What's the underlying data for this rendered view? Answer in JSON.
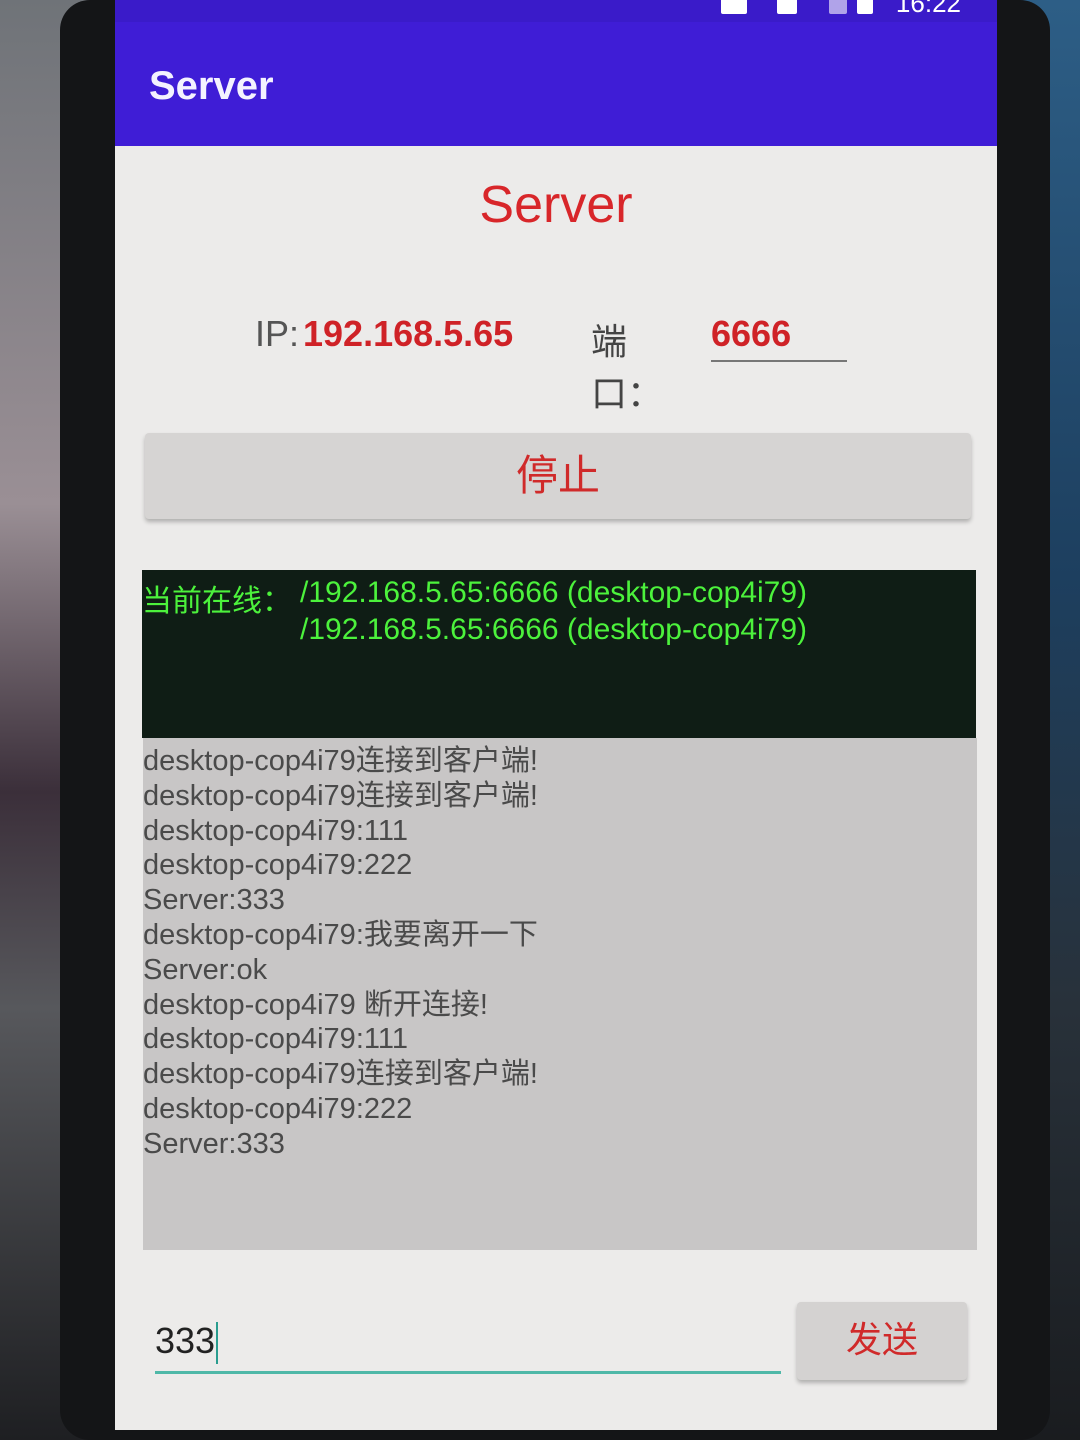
{
  "status_bar": {
    "time": "16:22"
  },
  "app_bar": {
    "title": "Server"
  },
  "main": {
    "heading": "Server",
    "ip_label": "IP:",
    "ip_value": "192.168.5.65",
    "port_label": "端口：",
    "port_value": "6666",
    "stop_button": "停止"
  },
  "online": {
    "label": "当前在线：",
    "clients": [
      "/192.168.5.65:6666 (desktop-cop4i79)",
      "/192.168.5.65:6666 (desktop-cop4i79)"
    ]
  },
  "log": [
    "desktop-cop4i79连接到客户端!",
    "desktop-cop4i79连接到客户端!",
    "desktop-cop4i79:111",
    "desktop-cop4i79:222",
    "Server:333",
    "desktop-cop4i79:我要离开一下",
    "Server:ok",
    "desktop-cop4i79 断开连接!",
    "desktop-cop4i79:111",
    "desktop-cop4i79连接到客户端!",
    "desktop-cop4i79:222",
    "Server:333"
  ],
  "composer": {
    "input_value": "333",
    "send_button": "发送"
  },
  "colors": {
    "app_bar": "#3f1dd6",
    "accent_red": "#d8262a",
    "online_text": "#4cf23c",
    "input_underline": "#4fb8a8"
  }
}
